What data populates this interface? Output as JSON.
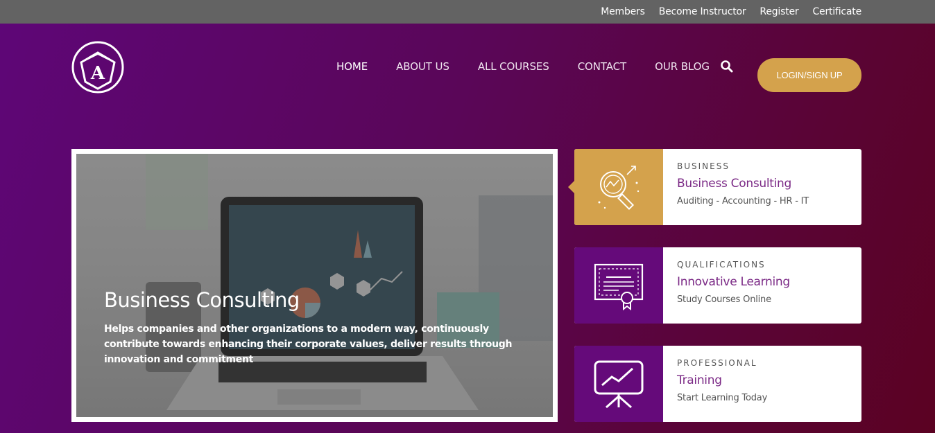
{
  "topbar": {
    "links": [
      "Members",
      "Become Instructor",
      "Register",
      "Certificate"
    ]
  },
  "header": {
    "logo_letter": "A",
    "nav": [
      "HOME",
      "ABOUT US",
      "ALL COURSES",
      "CONTACT",
      "OUR BLOG"
    ],
    "login_label": "LOGIN/SIGN UP"
  },
  "feature": {
    "title": "Business Consulting",
    "description": "Helps companies and other organizations to a modern way, continuously contribute towards enhancing their corporate values, deliver results through innovation and commitment"
  },
  "cards": [
    {
      "category": "BUSINESS",
      "title": "Business Consulting",
      "subtitle": "Auditing - Accounting - HR - IT",
      "icon": "magnifier-chart-icon",
      "color": "#d4a24c"
    },
    {
      "category": "QUALIFICATIONS",
      "title": "Innovative Learning",
      "subtitle": "Study Courses Online",
      "icon": "certificate-icon",
      "color": "#650a7a"
    },
    {
      "category": "PROFESSIONAL",
      "title": "Training",
      "subtitle": "Start Learning Today",
      "icon": "presentation-board-icon",
      "color": "#650a7a"
    }
  ],
  "colors": {
    "accent_gold": "#d4a24c",
    "brand_purple": "#650a7a",
    "topbar_gray": "#636363"
  }
}
